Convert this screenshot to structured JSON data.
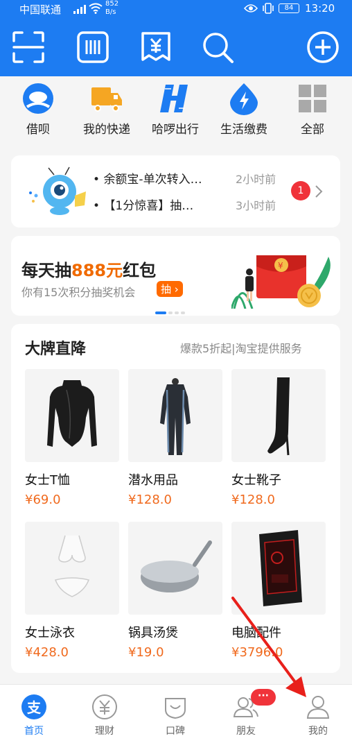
{
  "status_bar": {
    "carrier": "中国联通",
    "signal_type": "4G",
    "net_speed": "852",
    "net_speed_unit": "B/s",
    "battery": "84",
    "time": "13:20"
  },
  "toolbar": {
    "icons": [
      "scan-icon",
      "pay-code-icon",
      "collect-money-icon",
      "search-icon",
      "add-icon"
    ]
  },
  "quick_apps": [
    {
      "label": "借呗",
      "icon": "jiebei-icon"
    },
    {
      "label": "我的快递",
      "icon": "delivery-truck-icon"
    },
    {
      "label": "哈啰出行",
      "icon": "hellobike-icon"
    },
    {
      "label": "生活缴费",
      "icon": "utility-payment-icon"
    },
    {
      "label": "全部",
      "icon": "all-grid-icon"
    }
  ],
  "notifications": {
    "items": [
      {
        "text": "余额宝-单次转入…",
        "time": "2小时前"
      },
      {
        "text": "【1分惊喜】抽…",
        "time": "3小时前"
      }
    ],
    "badge": "1"
  },
  "lottery": {
    "title_prefix": "每天抽",
    "title_highlight": "888元",
    "title_suffix": "红包",
    "subtitle": "你有15次积分抽奖机会",
    "button": "抽"
  },
  "brand": {
    "title": "大牌直降",
    "subtitle": "爆款5折起|淘宝提供服务",
    "products": [
      {
        "name": "女士T恤",
        "price": "¥69.0"
      },
      {
        "name": "潜水用品",
        "price": "¥128.0"
      },
      {
        "name": "女士靴子",
        "price": "¥128.0"
      },
      {
        "name": "女士泳衣",
        "price": "¥428.0"
      },
      {
        "name": "锅具汤煲",
        "price": "¥19.0"
      },
      {
        "name": "电脑配件",
        "price": "¥3796.0"
      }
    ]
  },
  "tabs": [
    {
      "label": "首页",
      "active": true
    },
    {
      "label": "理财"
    },
    {
      "label": "口碑"
    },
    {
      "label": "朋友",
      "badge": "···"
    },
    {
      "label": "我的"
    }
  ],
  "colors": {
    "brand_blue": "#1d7cf2",
    "price_orange": "#f06a1e",
    "badge_red": "#f0333a",
    "annotation_red": "#e8201b"
  }
}
